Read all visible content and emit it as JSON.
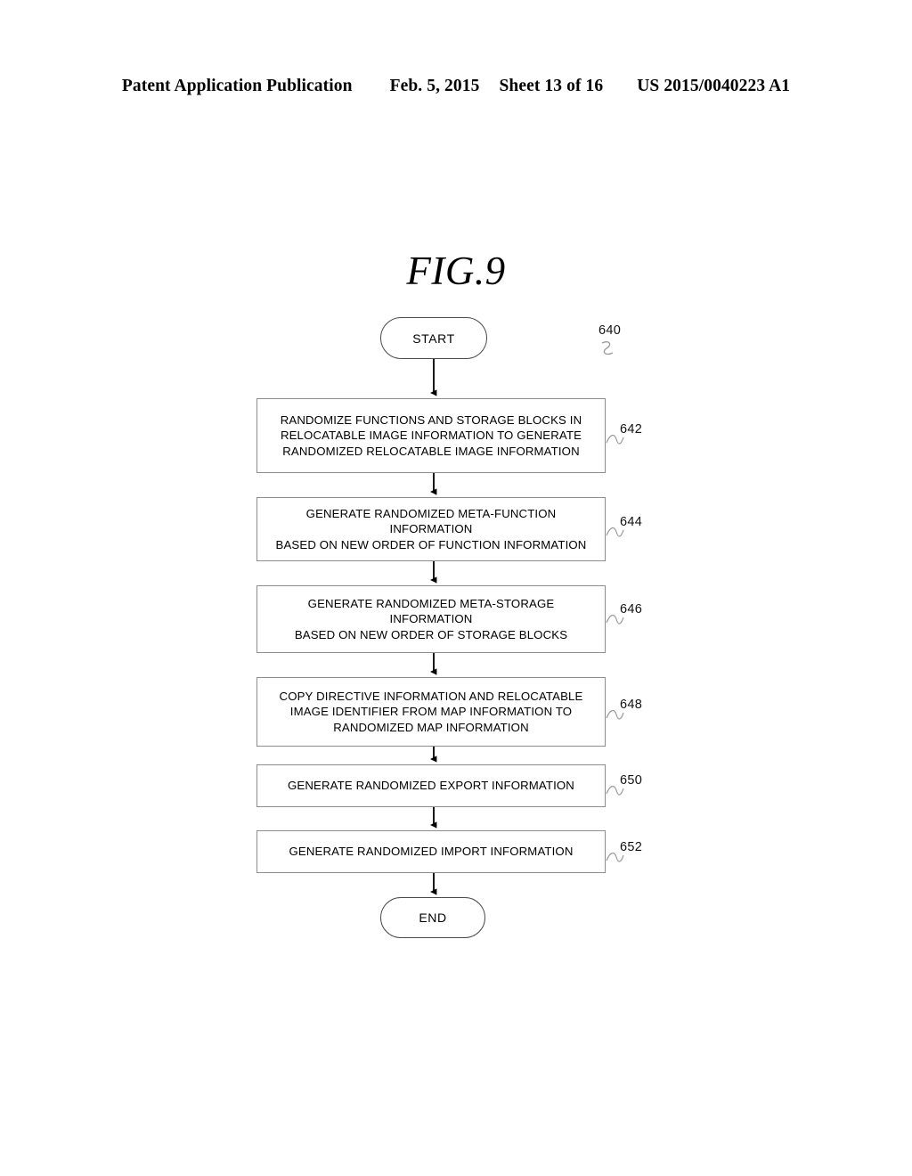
{
  "header": {
    "publication": "Patent Application Publication",
    "date": "Feb. 5, 2015",
    "sheet": "Sheet 13 of 16",
    "number": "US 2015/0040223 A1"
  },
  "figure": {
    "title": "FIG.9",
    "diagram_reference": "640"
  },
  "flowchart": {
    "start_label": "START",
    "end_label": "END",
    "steps": [
      {
        "ref": "642",
        "text": "RANDOMIZE FUNCTIONS AND STORAGE BLOCKS IN\nRELOCATABLE IMAGE INFORMATION TO GENERATE\nRANDOMIZED RELOCATABLE IMAGE INFORMATION"
      },
      {
        "ref": "644",
        "text": "GENERATE RANDOMIZED META-FUNCTION INFORMATION\nBASED ON NEW ORDER OF FUNCTION INFORMATION"
      },
      {
        "ref": "646",
        "text": "GENERATE RANDOMIZED META-STORAGE INFORMATION\nBASED ON NEW ORDER OF STORAGE BLOCKS"
      },
      {
        "ref": "648",
        "text": "COPY DIRECTIVE INFORMATION AND RELOCATABLE\nIMAGE IDENTIFIER FROM MAP INFORMATION TO\nRANDOMIZED MAP INFORMATION"
      },
      {
        "ref": "650",
        "text": "GENERATE RANDOMIZED EXPORT INFORMATION"
      },
      {
        "ref": "652",
        "text": "GENERATE RANDOMIZED IMPORT INFORMATION"
      }
    ]
  },
  "colors": {
    "ink": "#000000",
    "box_border": "#8d8d8d",
    "terminal_border": "#4a4a4a",
    "leader": "#9a9a9a",
    "page": "#ffffff"
  }
}
